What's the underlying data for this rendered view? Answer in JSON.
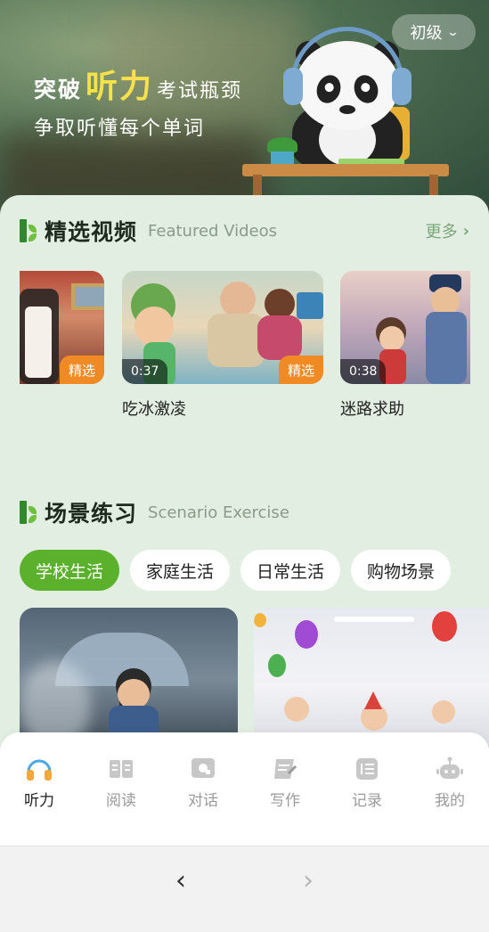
{
  "hero": {
    "line1_prefix": "突破",
    "line1_highlight": "听力",
    "line1_suffix": "考试瓶颈",
    "line2": "争取听懂每个单词",
    "level_label": "初级"
  },
  "featured": {
    "title": "精选视频",
    "subtitle": "Featured Videos",
    "more_label": "更多",
    "videos": [
      {
        "title": "",
        "tag": "精选",
        "duration": ""
      },
      {
        "title": "吃冰激凌",
        "tag": "精选",
        "duration": "0:37"
      },
      {
        "title": "迷路求助",
        "tag": "",
        "duration": "0:38"
      }
    ]
  },
  "scenario": {
    "title": "场景练习",
    "subtitle": "Scenario Exercise",
    "categories": [
      {
        "label": "学校生活",
        "active": true
      },
      {
        "label": "家庭生活",
        "active": false
      },
      {
        "label": "日常生活",
        "active": false
      },
      {
        "label": "购物场景",
        "active": false
      }
    ]
  },
  "tabbar": {
    "items": [
      {
        "label": "听力",
        "icon": "headphones-icon",
        "active": true
      },
      {
        "label": "阅读",
        "icon": "book-icon",
        "active": false
      },
      {
        "label": "对话",
        "icon": "chat-icon",
        "active": false
      },
      {
        "label": "写作",
        "icon": "write-icon",
        "active": false
      },
      {
        "label": "记录",
        "icon": "record-icon",
        "active": false
      },
      {
        "label": "我的",
        "icon": "robot-icon",
        "active": false
      }
    ]
  },
  "colors": {
    "accent_green": "#5bb02c",
    "tag_orange": "#f08a24",
    "highlight_yellow": "#f7e24b",
    "active_tab_blue": "#4aa8e8"
  },
  "browser_nav": {
    "back_glyph": "‹",
    "forward_glyph": "›"
  }
}
